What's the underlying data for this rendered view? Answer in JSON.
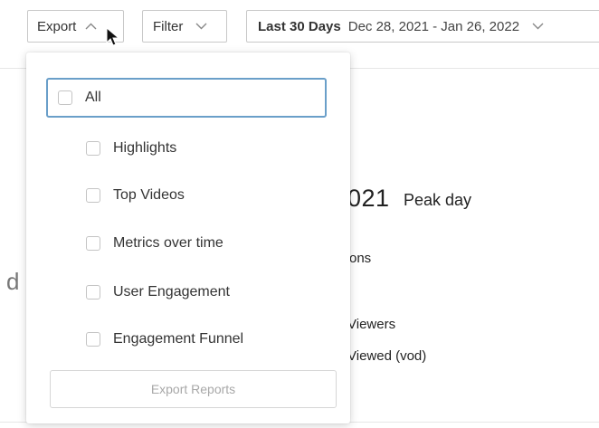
{
  "toolbar": {
    "export_label": "Export",
    "filter_label": "Filter",
    "date_range_label": "Last 30 Days",
    "date_range_value": "Dec 28, 2021 - Jan 26, 2022"
  },
  "background": {
    "peak_year_fragment": "021",
    "peak_day_label": "Peak day",
    "fragment_ons": "ons",
    "fragment_d": "d",
    "fragment_viewers": "Viewers",
    "fragment_viewed": "Viewed (vod)"
  },
  "export_menu": {
    "all_label": "All",
    "options": [
      {
        "label": "Highlights",
        "checked": false
      },
      {
        "label": "Top Videos",
        "checked": false
      },
      {
        "label": "Metrics over time",
        "checked": false
      },
      {
        "label": "User Engagement",
        "checked": false
      },
      {
        "label": "Engagement Funnel",
        "checked": false
      }
    ],
    "all_checked": false,
    "button_label": "Export Reports"
  },
  "colors": {
    "focus_border": "#6a9fc9",
    "disabled_text": "#a8a8a8",
    "control_border": "#c8c8c8"
  },
  "icons": {
    "export_toggle": "chevron-up-icon",
    "filter_toggle": "chevron-down-icon",
    "date_range_toggle": "chevron-down-icon",
    "cursor": "mouse-pointer-icon"
  }
}
